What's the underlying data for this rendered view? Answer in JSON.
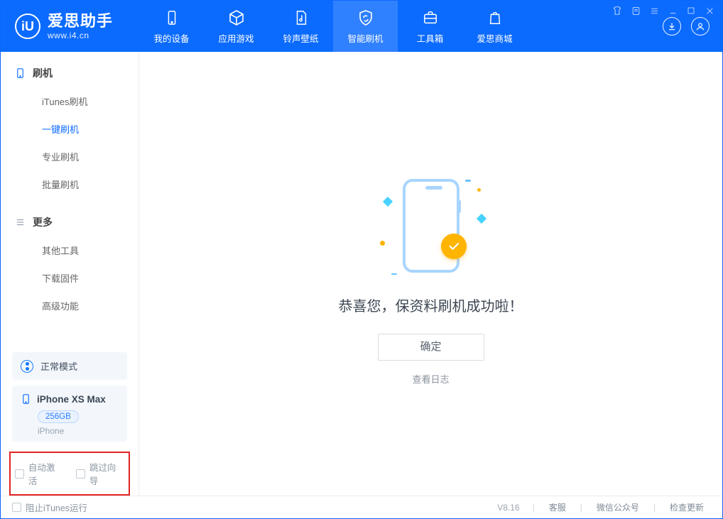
{
  "brand": {
    "name": "爱思助手",
    "url": "www.i4.cn",
    "logo_letter": "iU"
  },
  "nav": [
    {
      "key": "device",
      "label": "我的设备"
    },
    {
      "key": "apps",
      "label": "应用游戏"
    },
    {
      "key": "ring",
      "label": "铃声壁纸"
    },
    {
      "key": "flash",
      "label": "智能刷机",
      "active": true
    },
    {
      "key": "tool",
      "label": "工具箱"
    },
    {
      "key": "store",
      "label": "爱思商城"
    }
  ],
  "sidebar": {
    "section1": {
      "title": "刷机",
      "items": [
        "iTunes刷机",
        "一键刷机",
        "专业刷机",
        "批量刷机"
      ],
      "active_index": 1
    },
    "section2": {
      "title": "更多",
      "items": [
        "其他工具",
        "下载固件",
        "高级功能"
      ]
    },
    "mode": {
      "label": "正常模式"
    },
    "device": {
      "name": "iPhone XS Max",
      "storage": "256GB",
      "type": "iPhone"
    },
    "red_options": {
      "auto_activate": "自动激活",
      "skip_guide": "跳过向导"
    }
  },
  "main": {
    "success_title": "恭喜您，保资料刷机成功啦！",
    "ok_button": "确定",
    "log_link": "查看日志"
  },
  "footer": {
    "block_itunes": "阻止iTunes运行",
    "version": "V8.16",
    "links": [
      "客服",
      "微信公众号",
      "检查更新"
    ]
  }
}
